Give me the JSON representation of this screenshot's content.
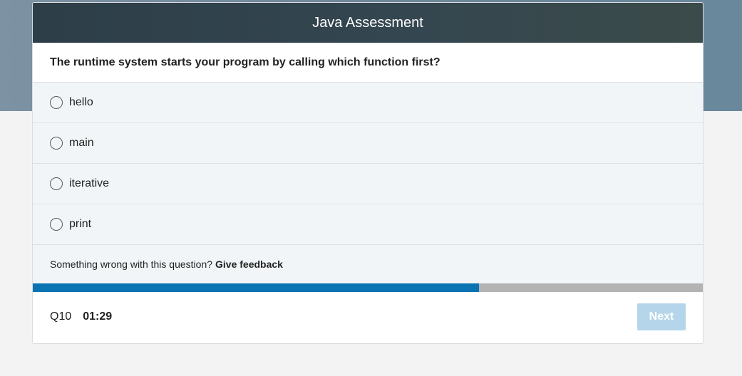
{
  "header": {
    "title": "Java Assessment"
  },
  "question": {
    "text": "The runtime system starts your program by calling which function first?"
  },
  "options": [
    {
      "label": "hello"
    },
    {
      "label": "main"
    },
    {
      "label": "iterative"
    },
    {
      "label": "print"
    }
  ],
  "feedback": {
    "prompt": "Something wrong with this question?",
    "link_label": "Give feedback"
  },
  "progress": {
    "fraction": 0.666
  },
  "footer": {
    "question_number": "Q10",
    "timer": "01:29",
    "next_label": "Next"
  },
  "colors": {
    "progress_fill": "#0a73b1",
    "progress_track": "#b3b3b3",
    "next_button_disabled": "#b5d5ea"
  }
}
